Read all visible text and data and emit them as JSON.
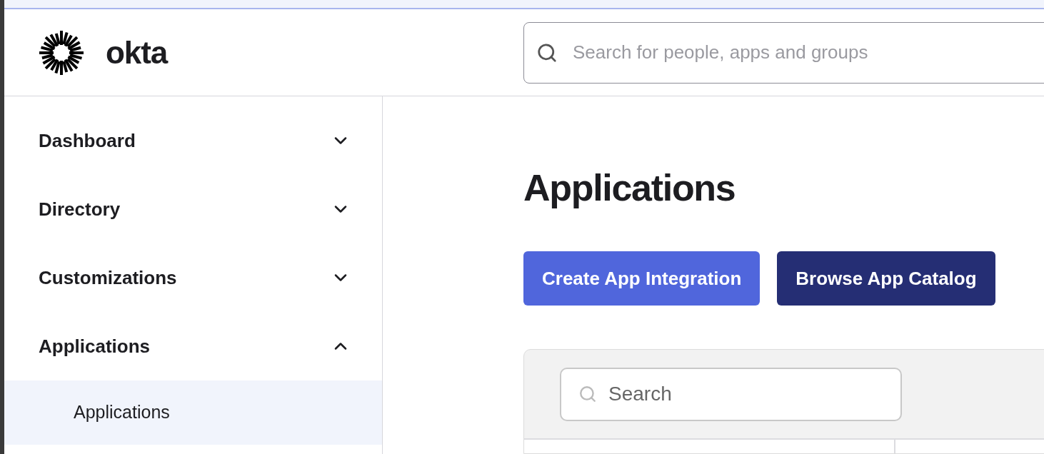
{
  "header": {
    "logo_text": "okta",
    "search": {
      "placeholder": "Search for people, apps and groups"
    }
  },
  "sidebar": {
    "items": [
      {
        "label": "Dashboard",
        "expanded": false
      },
      {
        "label": "Directory",
        "expanded": false
      },
      {
        "label": "Customizations",
        "expanded": false
      },
      {
        "label": "Applications",
        "expanded": true,
        "children": [
          {
            "label": "Applications",
            "selected": true
          }
        ]
      }
    ]
  },
  "main": {
    "title": "Applications",
    "buttons": [
      {
        "label": "Create App Integration",
        "kind": "primary"
      },
      {
        "label": "Browse App Catalog",
        "kind": "secondary"
      }
    ],
    "filter": {
      "search": {
        "placeholder": "Search"
      }
    }
  }
}
